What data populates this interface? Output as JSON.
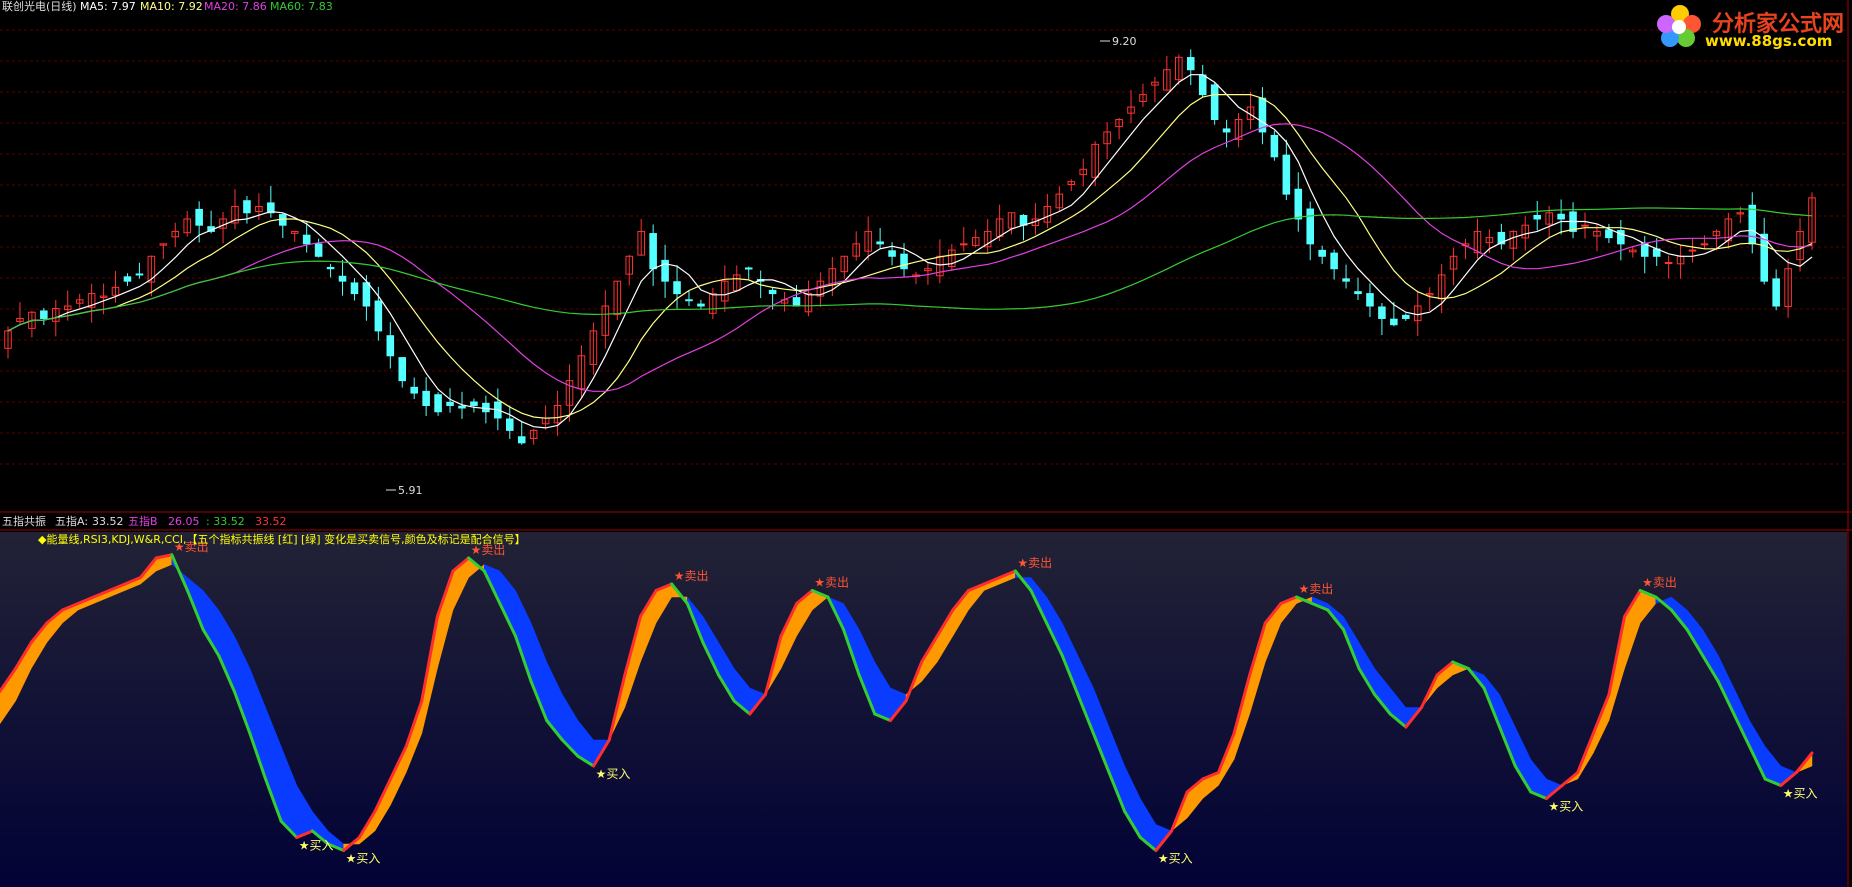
{
  "header": {
    "security": "联创光电(日线)",
    "ma5_label": "MA5: 7.97",
    "ma10_label": "MA10: 7.92",
    "ma20_label": "MA20: 7.86",
    "ma60_label": "MA60: 7.83"
  },
  "colors": {
    "background": "#000000",
    "grid": "#5a0000",
    "up": "#ff3232",
    "down": "#54ffff",
    "ma5": "#ffffff",
    "ma10": "#ffff88",
    "ma20": "#e040e0",
    "ma60": "#33cc33",
    "fill_up": "#ff9900",
    "fill_down": "#0a3cff",
    "signal": "#ff2d2d",
    "panel_top": "#222238",
    "panel_bottom": "#030336"
  },
  "price_panel": {
    "high_label": "9.20",
    "low_label": "5.91",
    "marker_buy": "B",
    "marker_sell": "S"
  },
  "indicator_panel": {
    "name": "五指共振",
    "a_label": "五指A:",
    "a_value": "33.52",
    "b_label": "五指B",
    "b_value": "26.05",
    "c_value": ": 33.52",
    "d_value": "33.52",
    "description": "◆能量线,RSI3,KDJ,W&R,CCI,【五个指标共振线 [红] [绿] 变化是买卖信号,颜色及标记是配合信号】",
    "buy_text": "★买入",
    "sell_text": "★卖出"
  },
  "watermark": {
    "name": "分析家公式网",
    "url": "www.88gs.com",
    "logo_icon": "flower-icon"
  },
  "chart_data": [
    {
      "type": "candlestick",
      "title": "联创光电(日线)",
      "ylim": [
        5.5,
        9.4
      ],
      "high": 9.2,
      "low": 5.91,
      "series": [
        {
          "name": "MA5",
          "last": 7.97
        },
        {
          "name": "MA10",
          "last": 7.92
        },
        {
          "name": "MA20",
          "last": 7.86
        },
        {
          "name": "MA60",
          "last": 7.83
        }
      ],
      "closes": [
        6.9,
        7.0,
        7.05,
        7.0,
        7.08,
        7.1,
        7.15,
        7.2,
        7.18,
        7.25,
        7.3,
        7.35,
        7.5,
        7.6,
        7.7,
        7.8,
        7.75,
        7.7,
        7.8,
        7.9,
        7.85,
        7.9,
        7.85,
        7.75,
        7.7,
        7.6,
        7.5,
        7.4,
        7.3,
        7.2,
        7.1,
        6.9,
        6.7,
        6.5,
        6.4,
        6.3,
        6.25,
        6.3,
        6.28,
        6.3,
        6.25,
        6.2,
        6.1,
        6.0,
        6.1,
        6.2,
        6.3,
        6.5,
        6.7,
        6.9,
        7.1,
        7.3,
        7.5,
        7.7,
        7.4,
        7.3,
        7.2,
        7.15,
        7.1,
        7.2,
        7.3,
        7.35,
        7.4,
        7.3,
        7.2,
        7.15,
        7.1,
        7.2,
        7.3,
        7.4,
        7.5,
        7.6,
        7.7,
        7.6,
        7.5,
        7.4,
        7.35,
        7.4,
        7.5,
        7.55,
        7.6,
        7.65,
        7.7,
        7.8,
        7.85,
        7.75,
        7.8,
        7.9,
        8.0,
        8.1,
        8.2,
        8.4,
        8.5,
        8.6,
        8.7,
        8.8,
        8.9,
        9.0,
        9.1,
        9.0,
        8.8,
        8.6,
        8.5,
        8.6,
        8.7,
        8.5,
        8.3,
        8.0,
        7.8,
        7.6,
        7.5,
        7.4,
        7.3,
        7.2,
        7.1,
        7.0,
        6.95,
        7.0,
        7.1,
        7.2,
        7.35,
        7.5,
        7.6,
        7.7,
        7.65,
        7.6,
        7.7,
        7.75,
        7.8,
        7.85,
        7.8,
        7.7,
        7.75,
        7.7,
        7.65,
        7.6,
        7.55,
        7.5,
        7.5,
        7.45,
        7.5,
        7.55,
        7.6,
        7.7,
        7.8,
        7.85,
        7.6,
        7.3,
        7.1,
        7.4,
        7.7,
        7.97
      ],
      "ohlc_note": "Per-bar values estimated from the price scale; candle colors red=up, cyan=down."
    },
    {
      "type": "area",
      "title": "五指共振",
      "ylim": [
        0,
        100
      ],
      "series": [
        {
          "name": "五指A",
          "last": 33.52,
          "values": [
            55,
            62,
            70,
            76,
            80,
            82,
            84,
            86,
            88,
            90,
            96,
            97,
            86,
            74,
            66,
            55,
            42,
            28,
            15,
            10,
            12,
            8,
            6,
            10,
            18,
            28,
            38,
            52,
            78,
            92,
            96,
            92,
            82,
            72,
            58,
            46,
            40,
            35,
            32,
            40,
            60,
            78,
            86,
            88,
            82,
            70,
            60,
            52,
            48,
            54,
            72,
            82,
            86,
            84,
            74,
            60,
            48,
            46,
            52,
            64,
            72,
            80,
            86,
            88,
            90,
            92,
            86,
            76,
            66,
            54,
            42,
            30,
            18,
            10,
            6,
            12,
            24,
            28,
            30,
            42,
            60,
            76,
            82,
            84,
            82,
            80,
            74,
            62,
            54,
            48,
            44,
            50,
            60,
            64,
            62,
            56,
            44,
            32,
            24,
            22,
            26,
            30,
            42,
            54,
            78,
            86,
            84,
            80,
            74,
            66,
            58,
            48,
            38,
            28,
            26,
            30,
            36
          ]
        },
        {
          "name": "五指B",
          "last": 26.05,
          "values": [
            45,
            52,
            62,
            70,
            76,
            80,
            82,
            84,
            86,
            88,
            92,
            94,
            90,
            86,
            80,
            72,
            62,
            50,
            38,
            26,
            18,
            12,
            8,
            8,
            12,
            20,
            30,
            42,
            62,
            80,
            90,
            94,
            92,
            86,
            76,
            64,
            54,
            46,
            40,
            40,
            50,
            64,
            76,
            84,
            84,
            78,
            70,
            62,
            56,
            54,
            62,
            72,
            80,
            84,
            82,
            74,
            64,
            56,
            54,
            58,
            64,
            72,
            80,
            86,
            88,
            90,
            90,
            84,
            76,
            66,
            56,
            44,
            32,
            22,
            14,
            12,
            16,
            22,
            26,
            34,
            48,
            64,
            76,
            82,
            84,
            82,
            78,
            70,
            62,
            56,
            50,
            50,
            56,
            60,
            62,
            60,
            54,
            44,
            34,
            28,
            26,
            28,
            36,
            46,
            62,
            76,
            82,
            84,
            80,
            74,
            66,
            56,
            46,
            38,
            32,
            30,
            32
          ]
        }
      ],
      "signals": {
        "sell_label": "★卖出",
        "buy_label": "★买入"
      }
    }
  ]
}
